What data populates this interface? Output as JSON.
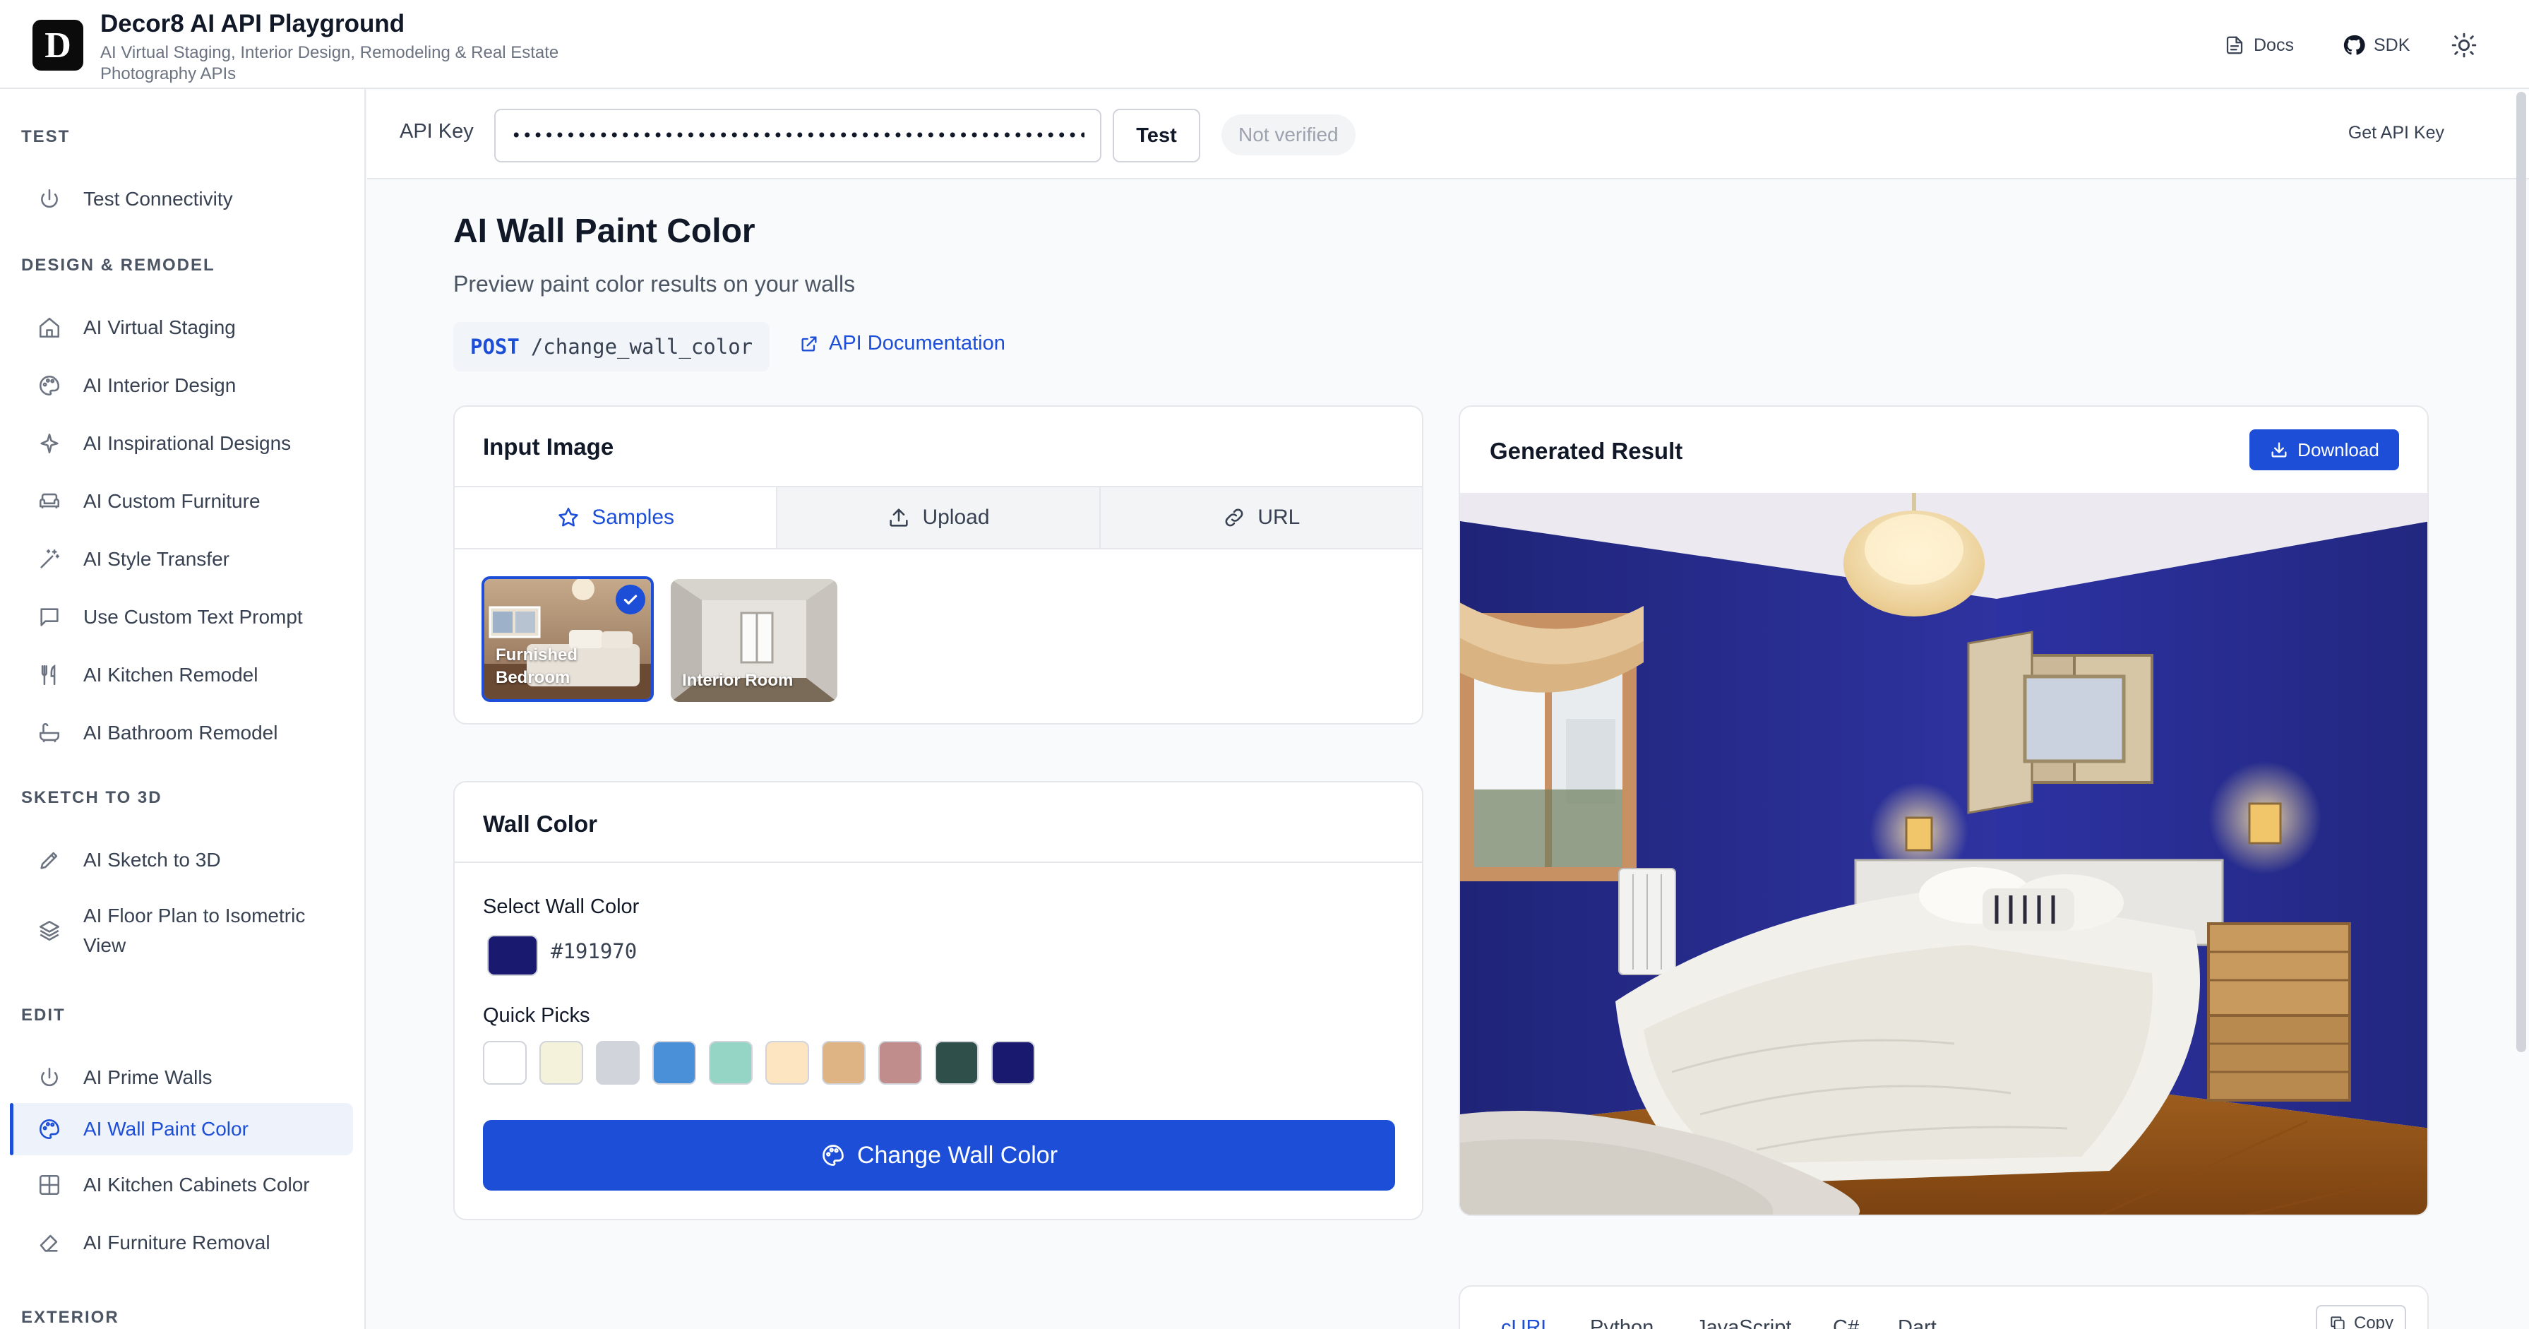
{
  "header": {
    "logo_letter": "D",
    "title": "Decor8 AI API Playground",
    "subtitle": "AI Virtual Staging, Interior Design, Remodeling & Real Estate Photography APIs",
    "docs_label": "Docs",
    "sdk_label": "SDK"
  },
  "sidebar": {
    "sections": [
      {
        "heading": "TEST",
        "items": [
          {
            "label": "Test Connectivity",
            "icon": "power-icon"
          }
        ]
      },
      {
        "heading": "DESIGN & REMODEL",
        "items": [
          {
            "label": "AI Virtual Staging",
            "icon": "home-icon"
          },
          {
            "label": "AI Interior Design",
            "icon": "palette-icon"
          },
          {
            "label": "AI Inspirational Designs",
            "icon": "sparkle-icon"
          },
          {
            "label": "AI Custom Furniture",
            "icon": "sofa-icon"
          },
          {
            "label": "AI Style Transfer",
            "icon": "wand-icon"
          },
          {
            "label": "Use Custom Text Prompt",
            "icon": "message-icon"
          },
          {
            "label": "AI Kitchen Remodel",
            "icon": "utensils-icon"
          },
          {
            "label": "AI Bathroom Remodel",
            "icon": "bath-icon"
          }
        ]
      },
      {
        "heading": "SKETCH TO 3D",
        "items": [
          {
            "label": "AI Sketch to 3D",
            "icon": "pencil-icon"
          },
          {
            "label": "AI Floor Plan to Isometric View",
            "icon": "layers-icon"
          }
        ]
      },
      {
        "heading": "EDIT",
        "items": [
          {
            "label": "AI Prime Walls",
            "icon": "power-icon"
          },
          {
            "label": "AI Wall Paint Color",
            "icon": "palette-icon",
            "active": true
          },
          {
            "label": "AI Kitchen Cabinets Color",
            "icon": "grid-icon"
          },
          {
            "label": "AI Furniture Removal",
            "icon": "eraser-icon"
          }
        ]
      },
      {
        "heading": "EXTERIOR",
        "items": []
      }
    ]
  },
  "apibar": {
    "label": "API Key",
    "key_value": "••••••••••••••••••••••••••••••••••••••••••••••••••••••••••••",
    "test_label": "Test",
    "status": "Not verified",
    "get_key_label": "Get API Key"
  },
  "page": {
    "title": "AI Wall Paint Color",
    "description": "Preview paint color results on your walls",
    "method": "POST",
    "endpoint": "/change_wall_color",
    "doc_link": "API Documentation"
  },
  "input_card": {
    "title": "Input Image",
    "tabs": [
      {
        "label": "Samples",
        "icon": "star-icon"
      },
      {
        "label": "Upload",
        "icon": "upload-icon"
      },
      {
        "label": "URL",
        "icon": "link-icon"
      }
    ],
    "samples": [
      {
        "line1": "Furnished",
        "line2": "Bedroom",
        "selected": true
      },
      {
        "line1": "Interior Room",
        "line2": "",
        "selected": false
      }
    ]
  },
  "wall_card": {
    "title": "Wall Color",
    "select_label": "Select Wall Color",
    "selected_color": "#191970",
    "quick_picks_label": "Quick Picks",
    "quick_picks": [
      "#ffffff",
      "#f5f2dc",
      "#d1d5db",
      "#4a90d9",
      "#95d5c5",
      "#fde5c2",
      "#deb485",
      "#c08c8c",
      "#2f4f4a",
      "#191970"
    ],
    "button_label": "Change Wall Color"
  },
  "result_card": {
    "title": "Generated Result",
    "download_label": "Download"
  },
  "code_card": {
    "tabs": [
      "cURL",
      "Python",
      "JavaScript",
      "C#",
      "Dart"
    ],
    "copy_label": "Copy"
  },
  "colors": {
    "accent": "#1d4ed8",
    "wall_blue": "#2a2f8f"
  }
}
